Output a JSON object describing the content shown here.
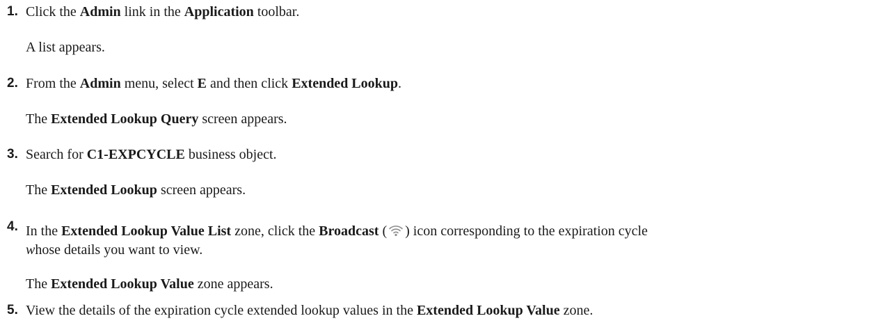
{
  "steps": [
    {
      "number": "1.",
      "instruction": {
        "t1": "Click the ",
        "b1": "Admin",
        "t2": " link in the ",
        "b2": "Application",
        "t3": " toolbar."
      },
      "result": {
        "t1": "A list appears."
      }
    },
    {
      "number": "2.",
      "instruction": {
        "t1": "From the ",
        "b1": "Admin",
        "t2": " menu, select ",
        "b2": "E",
        "t3": " and then click ",
        "b3": "Extended Lookup",
        "t4": "."
      },
      "result": {
        "t1": "The ",
        "b1": "Extended Lookup Query",
        "t2": " screen appears."
      }
    },
    {
      "number": "3.",
      "instruction": {
        "t1": "Search for ",
        "b1": "C1-EXPCYCLE",
        "t2": " business object."
      },
      "result": {
        "t1": "The ",
        "b1": "Extended Lookup",
        "t2": " screen appears."
      }
    },
    {
      "number": "4.",
      "instruction": {
        "t1": "In the ",
        "b1": "Extended Lookup Value List",
        "t2": " zone, click the ",
        "b2": "Broadcast",
        "t3": " (",
        "t4": ") icon corresponding to the expiration cycle",
        "i1": "w",
        "t5": "hose details you want to view."
      },
      "icon": "broadcast-icon",
      "result": {
        "t1": "The ",
        "b1": "Extended Lookup Value",
        "t2": " zone appears."
      }
    },
    {
      "number": "5.",
      "instruction": {
        "t1": "View the details of the expiration cycle extended lookup values in the ",
        "b1": "Extended Lookup Value",
        "t2": " zone."
      }
    }
  ],
  "colors": {
    "text": "#1a1a1a",
    "icon": "#8c8c8c"
  }
}
